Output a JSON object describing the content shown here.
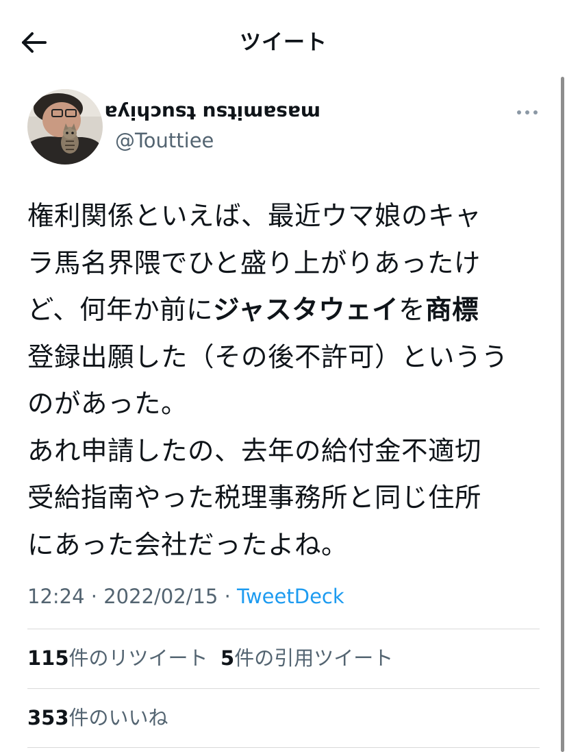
{
  "header": {
    "title": "ツイート",
    "back_icon": "arrow-left-icon"
  },
  "author": {
    "display_name": "masamitsu tsuchiya",
    "handle": "@Touttiee",
    "more_icon": "more-horizontal-icon"
  },
  "tweet": {
    "lines": [
      [
        {
          "t": "権利関係といえば、最近ウマ娘のキャ",
          "b": false
        }
      ],
      [
        {
          "t": "ラ馬名界隈でひと盛り上がりあったけ",
          "b": false
        }
      ],
      [
        {
          "t": "ど、何年か前に",
          "b": false
        },
        {
          "t": "ジャスタウェイ",
          "b": true
        },
        {
          "t": "を",
          "b": false
        },
        {
          "t": "商標",
          "b": true
        }
      ],
      [
        {
          "t": "登録出願した（その後不許可）というう",
          "b": false
        }
      ],
      [
        {
          "t": "のがあった。",
          "b": false
        }
      ],
      [
        {
          "t": "あれ申請したの、去年の給付金不適切",
          "b": false
        }
      ],
      [
        {
          "t": "受給指南やった税理事務所と同じ住所",
          "b": false
        }
      ],
      [
        {
          "t": "にあった会社だったよね。",
          "b": false
        }
      ]
    ]
  },
  "meta": {
    "time": "12:24",
    "sep1": " · ",
    "date": "2022/02/15",
    "sep2": " · ",
    "source": "TweetDeck"
  },
  "stats": {
    "retweets_count": "115",
    "retweets_label": "件のリツイート",
    "quotes_count": "5",
    "quotes_label": "件の引用ツイート",
    "likes_count": "353",
    "likes_label": "件のいいね"
  },
  "colors": {
    "text": "#0f1419",
    "secondary": "#536471",
    "link": "#1d9bf0",
    "divider": "#d9d9d9"
  }
}
